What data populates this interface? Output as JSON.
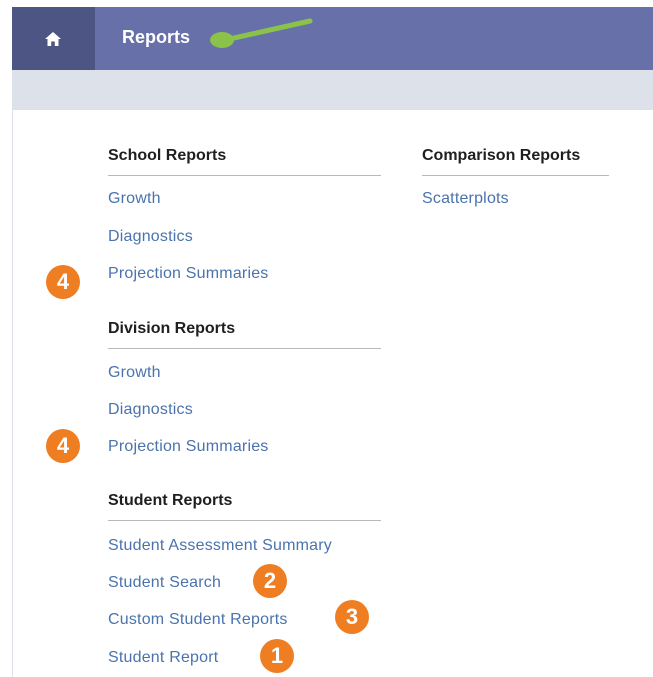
{
  "header": {
    "home_icon": "home-icon",
    "title": "Reports",
    "accent": "#6770a8",
    "arrow_color": "#8bc34a"
  },
  "school_reports": {
    "heading": "School Reports",
    "links": [
      "Growth",
      "Diagnostics",
      "Projection Summaries"
    ]
  },
  "comparison_reports": {
    "heading": "Comparison Reports",
    "links": [
      "Scatterplots"
    ]
  },
  "division_reports": {
    "heading": "Division Reports",
    "links": [
      "Growth",
      "Diagnostics",
      "Projection Summaries"
    ]
  },
  "student_reports": {
    "heading": "Student Reports",
    "links": [
      "Student Assessment Summary",
      "Student Search",
      "Custom Student Reports",
      "Student Report"
    ]
  },
  "badges": [
    "4",
    "4",
    "2",
    "3",
    "1"
  ],
  "badge_color": "#ef7d22"
}
